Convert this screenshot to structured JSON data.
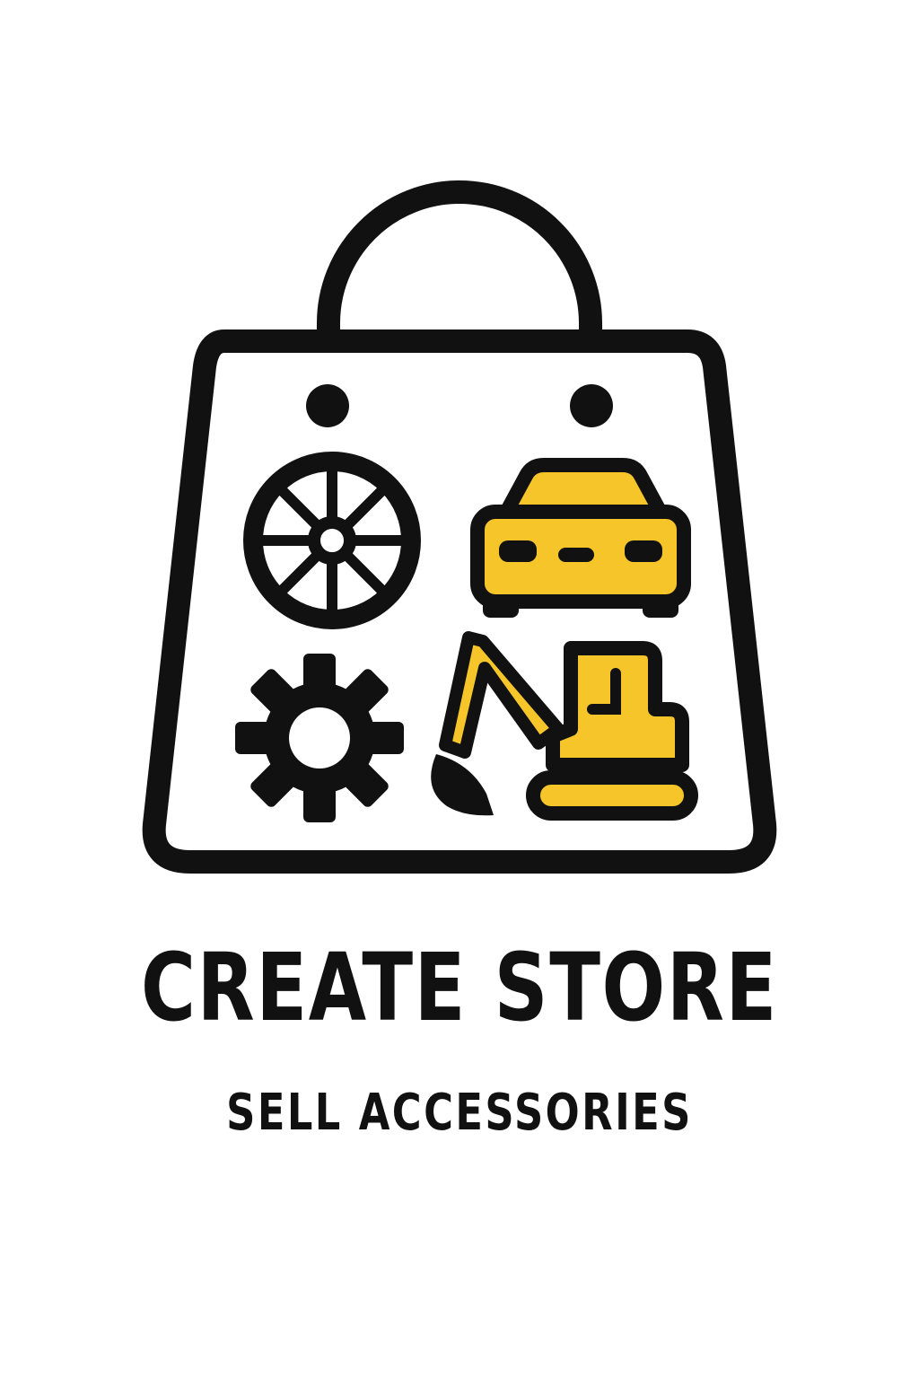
{
  "logo": {
    "title": "CREATE STORE",
    "subtitle": "SELL ACCESSORIES",
    "icons": [
      "shopping-bag-icon",
      "wheel-icon",
      "car-icon",
      "gear-icon",
      "excavator-icon"
    ]
  },
  "colors": {
    "ink": "#111111",
    "accent": "#F5C52A",
    "background": "#FFFFFF"
  }
}
